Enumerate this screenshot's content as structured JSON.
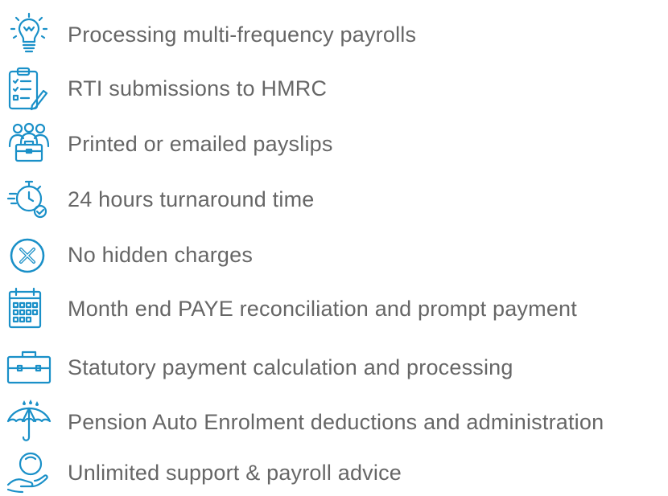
{
  "features": [
    {
      "icon": "lightbulb-icon",
      "label": "Processing multi-frequency payrolls"
    },
    {
      "icon": "clipboard-checklist-icon",
      "label": "RTI submissions to HMRC"
    },
    {
      "icon": "team-briefcase-icon",
      "label": "Printed or emailed payslips"
    },
    {
      "icon": "stopwatch-check-icon",
      "label": "24 hours turnaround time"
    },
    {
      "icon": "no-charges-icon",
      "label": "No hidden charges"
    },
    {
      "icon": "calendar-icon",
      "label": "Month end PAYE reconciliation and prompt payment"
    },
    {
      "icon": "briefcase-icon",
      "label": "Statutory payment calculation and processing"
    },
    {
      "icon": "umbrella-icon",
      "label": "Pension Auto Enrolment deductions and administration"
    },
    {
      "icon": "hand-coin-icon",
      "label": "Unlimited support & payroll advice"
    }
  ],
  "colors": {
    "icon": "#1a90c8",
    "text": "#666666",
    "background": "#ffffff"
  }
}
